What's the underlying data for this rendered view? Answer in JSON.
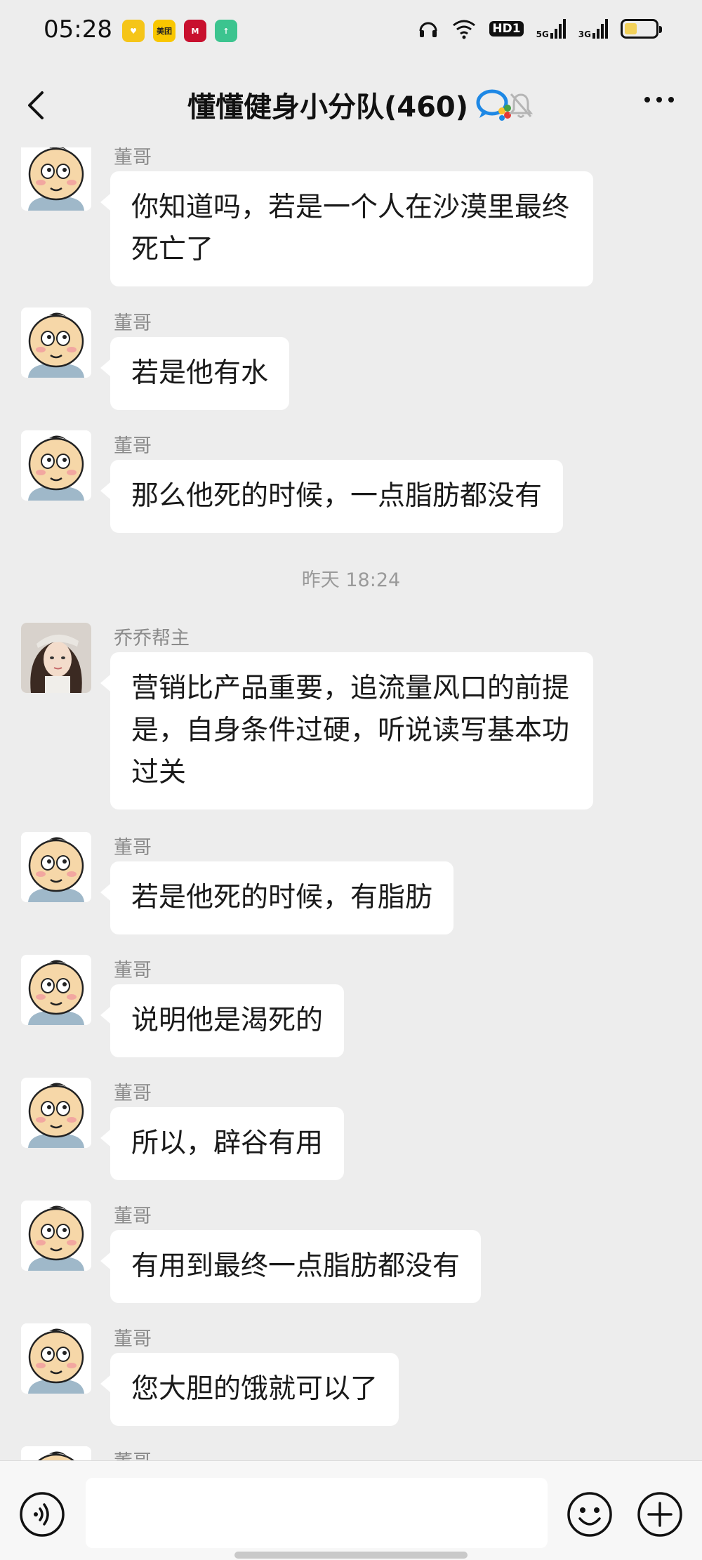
{
  "status_bar": {
    "time": "05:28",
    "apps": [
      {
        "name": "heart-app-icon",
        "label": "♥",
        "color": "#f5c518"
      },
      {
        "name": "meituan-app-icon",
        "label": "美团",
        "color": "#f9c700"
      },
      {
        "name": "cmb-app-icon",
        "label": "M",
        "color": "#c8102e"
      },
      {
        "name": "upload-app-icon",
        "label": "↑",
        "color": "#3cc48f"
      }
    ],
    "hd_label": "HD1",
    "net1": "5G",
    "net2": "3G"
  },
  "header": {
    "title": "懂懂健身小分队(460)"
  },
  "messages": [
    {
      "sender": "董哥",
      "text": "你知道吗，若是一个人在沙漠里最终死亡了",
      "avatar": "cartoon-baby"
    },
    {
      "sender": "董哥",
      "text": "若是他有水",
      "avatar": "cartoon-baby"
    },
    {
      "sender": "董哥",
      "text": "那么他死的时候，一点脂肪都没有",
      "avatar": "cartoon-baby"
    },
    {
      "timestamp": "昨天 18:24"
    },
    {
      "sender": "乔乔帮主",
      "text": "营销比产品重要，追流量风口的前提是，自身条件过硬，听说读写基本功过关",
      "avatar": "photo-girl"
    },
    {
      "sender": "董哥",
      "text": "若是他死的时候，有脂肪",
      "avatar": "cartoon-baby"
    },
    {
      "sender": "董哥",
      "text": "说明他是渴死的",
      "avatar": "cartoon-baby"
    },
    {
      "sender": "董哥",
      "text": "所以，辟谷有用",
      "avatar": "cartoon-baby"
    },
    {
      "sender": "董哥",
      "text": "有用到最终一点脂肪都没有",
      "avatar": "cartoon-baby"
    },
    {
      "sender": "董哥",
      "text": "您大胆的饿就可以了",
      "avatar": "cartoon-baby"
    },
    {
      "sender": "董哥",
      "text": "",
      "avatar": "cartoon-baby"
    }
  ],
  "input_bar": {
    "value": ""
  }
}
